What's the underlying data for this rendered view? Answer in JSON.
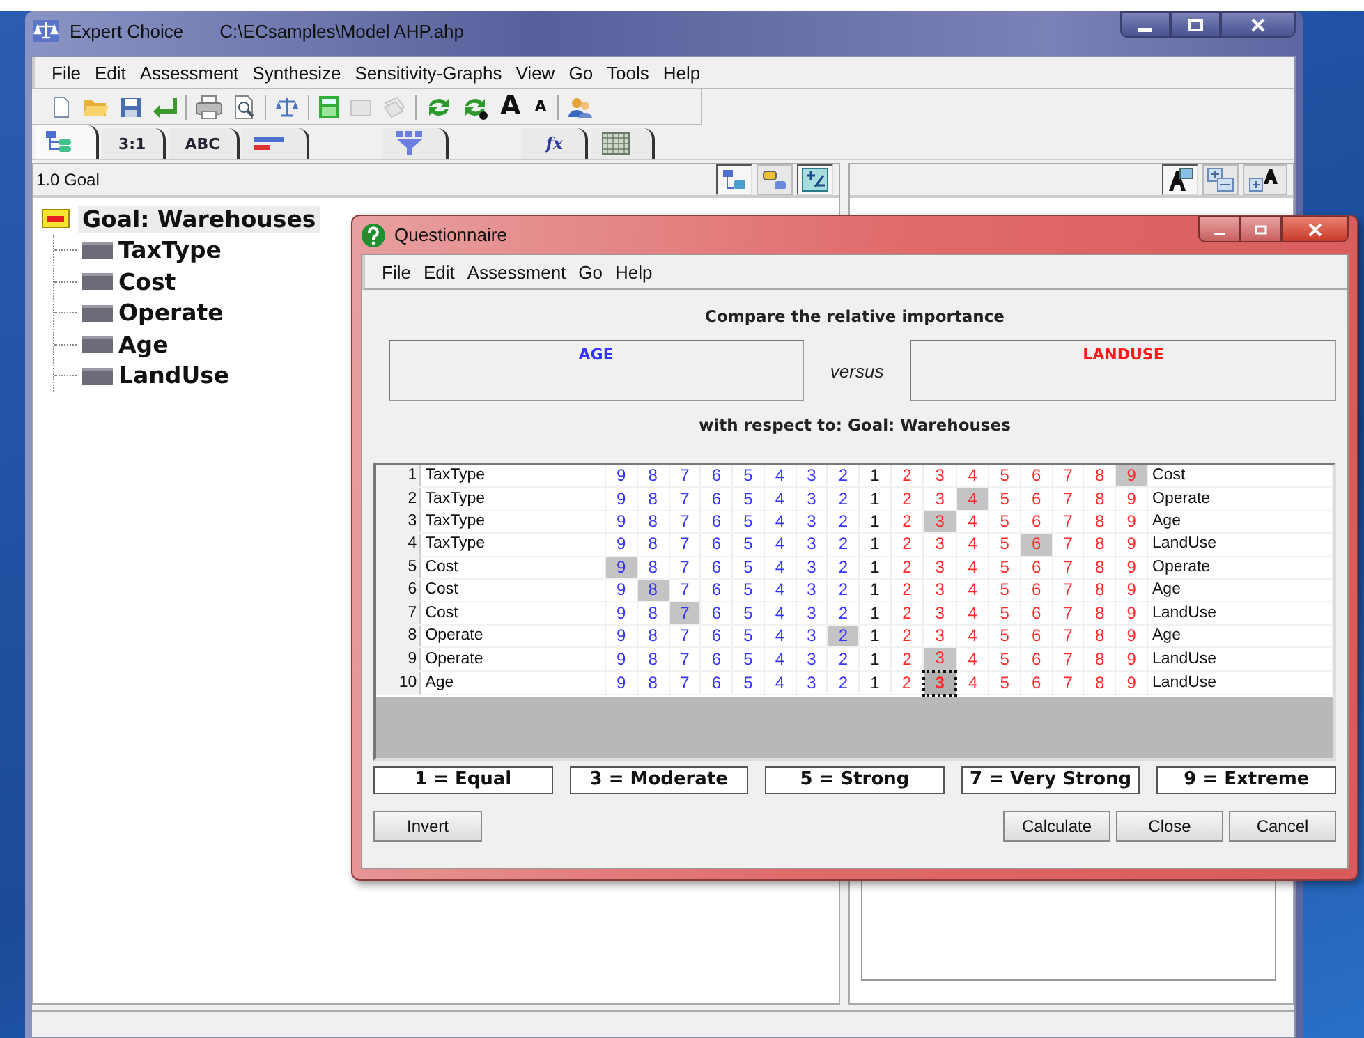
{
  "window": {
    "title": "Expert Choice",
    "path": "C:\\ECsamples\\Model AHP.ahp"
  },
  "menu": [
    "File",
    "Edit",
    "Assessment",
    "Synthesize",
    "Sensitivity-Graphs",
    "View",
    "Go",
    "Tools",
    "Help"
  ],
  "toolbar": {
    "font_larger_label": "A",
    "font_smaller_label": "A"
  },
  "tabs": [
    {
      "kind": "hierarchy",
      "selected": true
    },
    {
      "kind": "text",
      "label": "3:1",
      "selected": false
    },
    {
      "kind": "text",
      "label": "ABC",
      "selected": false
    },
    {
      "kind": "bars",
      "selected": false
    },
    {
      "kind": "funnel",
      "selected": false
    },
    {
      "kind": "formula",
      "label": "fx",
      "selected": false
    },
    {
      "kind": "grid",
      "selected": false
    }
  ],
  "left_pane": {
    "header": "1.0 Goal",
    "tree": {
      "label": "Goal: Warehouses",
      "selected": true,
      "children": [
        {
          "label": "TaxType",
          "selected": false
        },
        {
          "label": "Cost",
          "selected": false
        },
        {
          "label": "Operate",
          "selected": false
        },
        {
          "label": "Age",
          "selected": false
        },
        {
          "label": "LandUse",
          "selected": false
        }
      ]
    }
  },
  "dialog": {
    "title": "Questionnaire",
    "menu": [
      "File",
      "Edit",
      "Assessment",
      "Go",
      "Help"
    ],
    "heading": "Compare the relative importance",
    "left_item": "AGE",
    "versus": "versus",
    "right_item": "LANDUSE",
    "context": "with respect to: Goal: Warehouses",
    "rows": [
      {
        "number": "1",
        "left": "TaxType",
        "right": "Cost",
        "focused": false,
        "cells": [
          {
            "text": "9",
            "kind": "left",
            "selected": false
          },
          {
            "text": "8",
            "kind": "left",
            "selected": false
          },
          {
            "text": "7",
            "kind": "left",
            "selected": false
          },
          {
            "text": "6",
            "kind": "left",
            "selected": false
          },
          {
            "text": "5",
            "kind": "left",
            "selected": false
          },
          {
            "text": "4",
            "kind": "left",
            "selected": false
          },
          {
            "text": "3",
            "kind": "left",
            "selected": false
          },
          {
            "text": "2",
            "kind": "left",
            "selected": false
          },
          {
            "text": "1",
            "kind": "equal",
            "selected": false
          },
          {
            "text": "2",
            "kind": "right",
            "selected": false
          },
          {
            "text": "3",
            "kind": "right",
            "selected": false
          },
          {
            "text": "4",
            "kind": "right",
            "selected": false
          },
          {
            "text": "5",
            "kind": "right",
            "selected": false
          },
          {
            "text": "6",
            "kind": "right",
            "selected": false
          },
          {
            "text": "7",
            "kind": "right",
            "selected": false
          },
          {
            "text": "8",
            "kind": "right",
            "selected": false
          },
          {
            "text": "9",
            "kind": "right",
            "selected": true
          }
        ]
      },
      {
        "number": "2",
        "left": "TaxType",
        "right": "Operate",
        "focused": false,
        "cells": [
          {
            "text": "9",
            "kind": "left",
            "selected": false
          },
          {
            "text": "8",
            "kind": "left",
            "selected": false
          },
          {
            "text": "7",
            "kind": "left",
            "selected": false
          },
          {
            "text": "6",
            "kind": "left",
            "selected": false
          },
          {
            "text": "5",
            "kind": "left",
            "selected": false
          },
          {
            "text": "4",
            "kind": "left",
            "selected": false
          },
          {
            "text": "3",
            "kind": "left",
            "selected": false
          },
          {
            "text": "2",
            "kind": "left",
            "selected": false
          },
          {
            "text": "1",
            "kind": "equal",
            "selected": false
          },
          {
            "text": "2",
            "kind": "right",
            "selected": false
          },
          {
            "text": "3",
            "kind": "right",
            "selected": false
          },
          {
            "text": "4",
            "kind": "right",
            "selected": true
          },
          {
            "text": "5",
            "kind": "right",
            "selected": false
          },
          {
            "text": "6",
            "kind": "right",
            "selected": false
          },
          {
            "text": "7",
            "kind": "right",
            "selected": false
          },
          {
            "text": "8",
            "kind": "right",
            "selected": false
          },
          {
            "text": "9",
            "kind": "right",
            "selected": false
          }
        ]
      },
      {
        "number": "3",
        "left": "TaxType",
        "right": "Age",
        "focused": false,
        "cells": [
          {
            "text": "9",
            "kind": "left",
            "selected": false
          },
          {
            "text": "8",
            "kind": "left",
            "selected": false
          },
          {
            "text": "7",
            "kind": "left",
            "selected": false
          },
          {
            "text": "6",
            "kind": "left",
            "selected": false
          },
          {
            "text": "5",
            "kind": "left",
            "selected": false
          },
          {
            "text": "4",
            "kind": "left",
            "selected": false
          },
          {
            "text": "3",
            "kind": "left",
            "selected": false
          },
          {
            "text": "2",
            "kind": "left",
            "selected": false
          },
          {
            "text": "1",
            "kind": "equal",
            "selected": false
          },
          {
            "text": "2",
            "kind": "right",
            "selected": false
          },
          {
            "text": "3",
            "kind": "right",
            "selected": true
          },
          {
            "text": "4",
            "kind": "right",
            "selected": false
          },
          {
            "text": "5",
            "kind": "right",
            "selected": false
          },
          {
            "text": "6",
            "kind": "right",
            "selected": false
          },
          {
            "text": "7",
            "kind": "right",
            "selected": false
          },
          {
            "text": "8",
            "kind": "right",
            "selected": false
          },
          {
            "text": "9",
            "kind": "right",
            "selected": false
          }
        ]
      },
      {
        "number": "4",
        "left": "TaxType",
        "right": "LandUse",
        "focused": false,
        "cells": [
          {
            "text": "9",
            "kind": "left",
            "selected": false
          },
          {
            "text": "8",
            "kind": "left",
            "selected": false
          },
          {
            "text": "7",
            "kind": "left",
            "selected": false
          },
          {
            "text": "6",
            "kind": "left",
            "selected": false
          },
          {
            "text": "5",
            "kind": "left",
            "selected": false
          },
          {
            "text": "4",
            "kind": "left",
            "selected": false
          },
          {
            "text": "3",
            "kind": "left",
            "selected": false
          },
          {
            "text": "2",
            "kind": "left",
            "selected": false
          },
          {
            "text": "1",
            "kind": "equal",
            "selected": false
          },
          {
            "text": "2",
            "kind": "right",
            "selected": false
          },
          {
            "text": "3",
            "kind": "right",
            "selected": false
          },
          {
            "text": "4",
            "kind": "right",
            "selected": false
          },
          {
            "text": "5",
            "kind": "right",
            "selected": false
          },
          {
            "text": "6",
            "kind": "right",
            "selected": true
          },
          {
            "text": "7",
            "kind": "right",
            "selected": false
          },
          {
            "text": "8",
            "kind": "right",
            "selected": false
          },
          {
            "text": "9",
            "kind": "right",
            "selected": false
          }
        ]
      },
      {
        "number": "5",
        "left": "Cost",
        "right": "Operate",
        "focused": false,
        "cells": [
          {
            "text": "9",
            "kind": "left",
            "selected": true
          },
          {
            "text": "8",
            "kind": "left",
            "selected": false
          },
          {
            "text": "7",
            "kind": "left",
            "selected": false
          },
          {
            "text": "6",
            "kind": "left",
            "selected": false
          },
          {
            "text": "5",
            "kind": "left",
            "selected": false
          },
          {
            "text": "4",
            "kind": "left",
            "selected": false
          },
          {
            "text": "3",
            "kind": "left",
            "selected": false
          },
          {
            "text": "2",
            "kind": "left",
            "selected": false
          },
          {
            "text": "1",
            "kind": "equal",
            "selected": false
          },
          {
            "text": "2",
            "kind": "right",
            "selected": false
          },
          {
            "text": "3",
            "kind": "right",
            "selected": false
          },
          {
            "text": "4",
            "kind": "right",
            "selected": false
          },
          {
            "text": "5",
            "kind": "right",
            "selected": false
          },
          {
            "text": "6",
            "kind": "right",
            "selected": false
          },
          {
            "text": "7",
            "kind": "right",
            "selected": false
          },
          {
            "text": "8",
            "kind": "right",
            "selected": false
          },
          {
            "text": "9",
            "kind": "right",
            "selected": false
          }
        ]
      },
      {
        "number": "6",
        "left": "Cost",
        "right": "Age",
        "focused": false,
        "cells": [
          {
            "text": "9",
            "kind": "left",
            "selected": false
          },
          {
            "text": "8",
            "kind": "left",
            "selected": true
          },
          {
            "text": "7",
            "kind": "left",
            "selected": false
          },
          {
            "text": "6",
            "kind": "left",
            "selected": false
          },
          {
            "text": "5",
            "kind": "left",
            "selected": false
          },
          {
            "text": "4",
            "kind": "left",
            "selected": false
          },
          {
            "text": "3",
            "kind": "left",
            "selected": false
          },
          {
            "text": "2",
            "kind": "left",
            "selected": false
          },
          {
            "text": "1",
            "kind": "equal",
            "selected": false
          },
          {
            "text": "2",
            "kind": "right",
            "selected": false
          },
          {
            "text": "3",
            "kind": "right",
            "selected": false
          },
          {
            "text": "4",
            "kind": "right",
            "selected": false
          },
          {
            "text": "5",
            "kind": "right",
            "selected": false
          },
          {
            "text": "6",
            "kind": "right",
            "selected": false
          },
          {
            "text": "7",
            "kind": "right",
            "selected": false
          },
          {
            "text": "8",
            "kind": "right",
            "selected": false
          },
          {
            "text": "9",
            "kind": "right",
            "selected": false
          }
        ]
      },
      {
        "number": "7",
        "left": "Cost",
        "right": "LandUse",
        "focused": false,
        "cells": [
          {
            "text": "9",
            "kind": "left",
            "selected": false
          },
          {
            "text": "8",
            "kind": "left",
            "selected": false
          },
          {
            "text": "7",
            "kind": "left",
            "selected": true
          },
          {
            "text": "6",
            "kind": "left",
            "selected": false
          },
          {
            "text": "5",
            "kind": "left",
            "selected": false
          },
          {
            "text": "4",
            "kind": "left",
            "selected": false
          },
          {
            "text": "3",
            "kind": "left",
            "selected": false
          },
          {
            "text": "2",
            "kind": "left",
            "selected": false
          },
          {
            "text": "1",
            "kind": "equal",
            "selected": false
          },
          {
            "text": "2",
            "kind": "right",
            "selected": false
          },
          {
            "text": "3",
            "kind": "right",
            "selected": false
          },
          {
            "text": "4",
            "kind": "right",
            "selected": false
          },
          {
            "text": "5",
            "kind": "right",
            "selected": false
          },
          {
            "text": "6",
            "kind": "right",
            "selected": false
          },
          {
            "text": "7",
            "kind": "right",
            "selected": false
          },
          {
            "text": "8",
            "kind": "right",
            "selected": false
          },
          {
            "text": "9",
            "kind": "right",
            "selected": false
          }
        ]
      },
      {
        "number": "8",
        "left": "Operate",
        "right": "Age",
        "focused": false,
        "cells": [
          {
            "text": "9",
            "kind": "left",
            "selected": false
          },
          {
            "text": "8",
            "kind": "left",
            "selected": false
          },
          {
            "text": "7",
            "kind": "left",
            "selected": false
          },
          {
            "text": "6",
            "kind": "left",
            "selected": false
          },
          {
            "text": "5",
            "kind": "left",
            "selected": false
          },
          {
            "text": "4",
            "kind": "left",
            "selected": false
          },
          {
            "text": "3",
            "kind": "left",
            "selected": false
          },
          {
            "text": "2",
            "kind": "left",
            "selected": true
          },
          {
            "text": "1",
            "kind": "equal",
            "selected": false
          },
          {
            "text": "2",
            "kind": "right",
            "selected": false
          },
          {
            "text": "3",
            "kind": "right",
            "selected": false
          },
          {
            "text": "4",
            "kind": "right",
            "selected": false
          },
          {
            "text": "5",
            "kind": "right",
            "selected": false
          },
          {
            "text": "6",
            "kind": "right",
            "selected": false
          },
          {
            "text": "7",
            "kind": "right",
            "selected": false
          },
          {
            "text": "8",
            "kind": "right",
            "selected": false
          },
          {
            "text": "9",
            "kind": "right",
            "selected": false
          }
        ]
      },
      {
        "number": "9",
        "left": "Operate",
        "right": "LandUse",
        "focused": false,
        "cells": [
          {
            "text": "9",
            "kind": "left",
            "selected": false
          },
          {
            "text": "8",
            "kind": "left",
            "selected": false
          },
          {
            "text": "7",
            "kind": "left",
            "selected": false
          },
          {
            "text": "6",
            "kind": "left",
            "selected": false
          },
          {
            "text": "5",
            "kind": "left",
            "selected": false
          },
          {
            "text": "4",
            "kind": "left",
            "selected": false
          },
          {
            "text": "3",
            "kind": "left",
            "selected": false
          },
          {
            "text": "2",
            "kind": "left",
            "selected": false
          },
          {
            "text": "1",
            "kind": "equal",
            "selected": false
          },
          {
            "text": "2",
            "kind": "right",
            "selected": false
          },
          {
            "text": "3",
            "kind": "right",
            "selected": true
          },
          {
            "text": "4",
            "kind": "right",
            "selected": false
          },
          {
            "text": "5",
            "kind": "right",
            "selected": false
          },
          {
            "text": "6",
            "kind": "right",
            "selected": false
          },
          {
            "text": "7",
            "kind": "right",
            "selected": false
          },
          {
            "text": "8",
            "kind": "right",
            "selected": false
          },
          {
            "text": "9",
            "kind": "right",
            "selected": false
          }
        ]
      },
      {
        "number": "10",
        "left": "Age",
        "right": "LandUse",
        "focused": true,
        "cells": [
          {
            "text": "9",
            "kind": "left",
            "selected": false
          },
          {
            "text": "8",
            "kind": "left",
            "selected": false
          },
          {
            "text": "7",
            "kind": "left",
            "selected": false
          },
          {
            "text": "6",
            "kind": "left",
            "selected": false
          },
          {
            "text": "5",
            "kind": "left",
            "selected": false
          },
          {
            "text": "4",
            "kind": "left",
            "selected": false
          },
          {
            "text": "3",
            "kind": "left",
            "selected": false
          },
          {
            "text": "2",
            "kind": "left",
            "selected": false
          },
          {
            "text": "1",
            "kind": "equal",
            "selected": false
          },
          {
            "text": "2",
            "kind": "right",
            "selected": false
          },
          {
            "text": "3",
            "kind": "right",
            "selected": true
          },
          {
            "text": "4",
            "kind": "right",
            "selected": false
          },
          {
            "text": "5",
            "kind": "right",
            "selected": false
          },
          {
            "text": "6",
            "kind": "right",
            "selected": false
          },
          {
            "text": "7",
            "kind": "right",
            "selected": false
          },
          {
            "text": "8",
            "kind": "right",
            "selected": false
          },
          {
            "text": "9",
            "kind": "right",
            "selected": false
          }
        ]
      }
    ],
    "legend": [
      "1 = Equal",
      "3 = Moderate",
      "5 = Strong",
      "7 = Very Strong",
      "9 = Extreme"
    ],
    "left_buttons": [
      "Invert"
    ],
    "right_buttons": [
      "Calculate",
      "Close",
      "Cancel"
    ]
  }
}
